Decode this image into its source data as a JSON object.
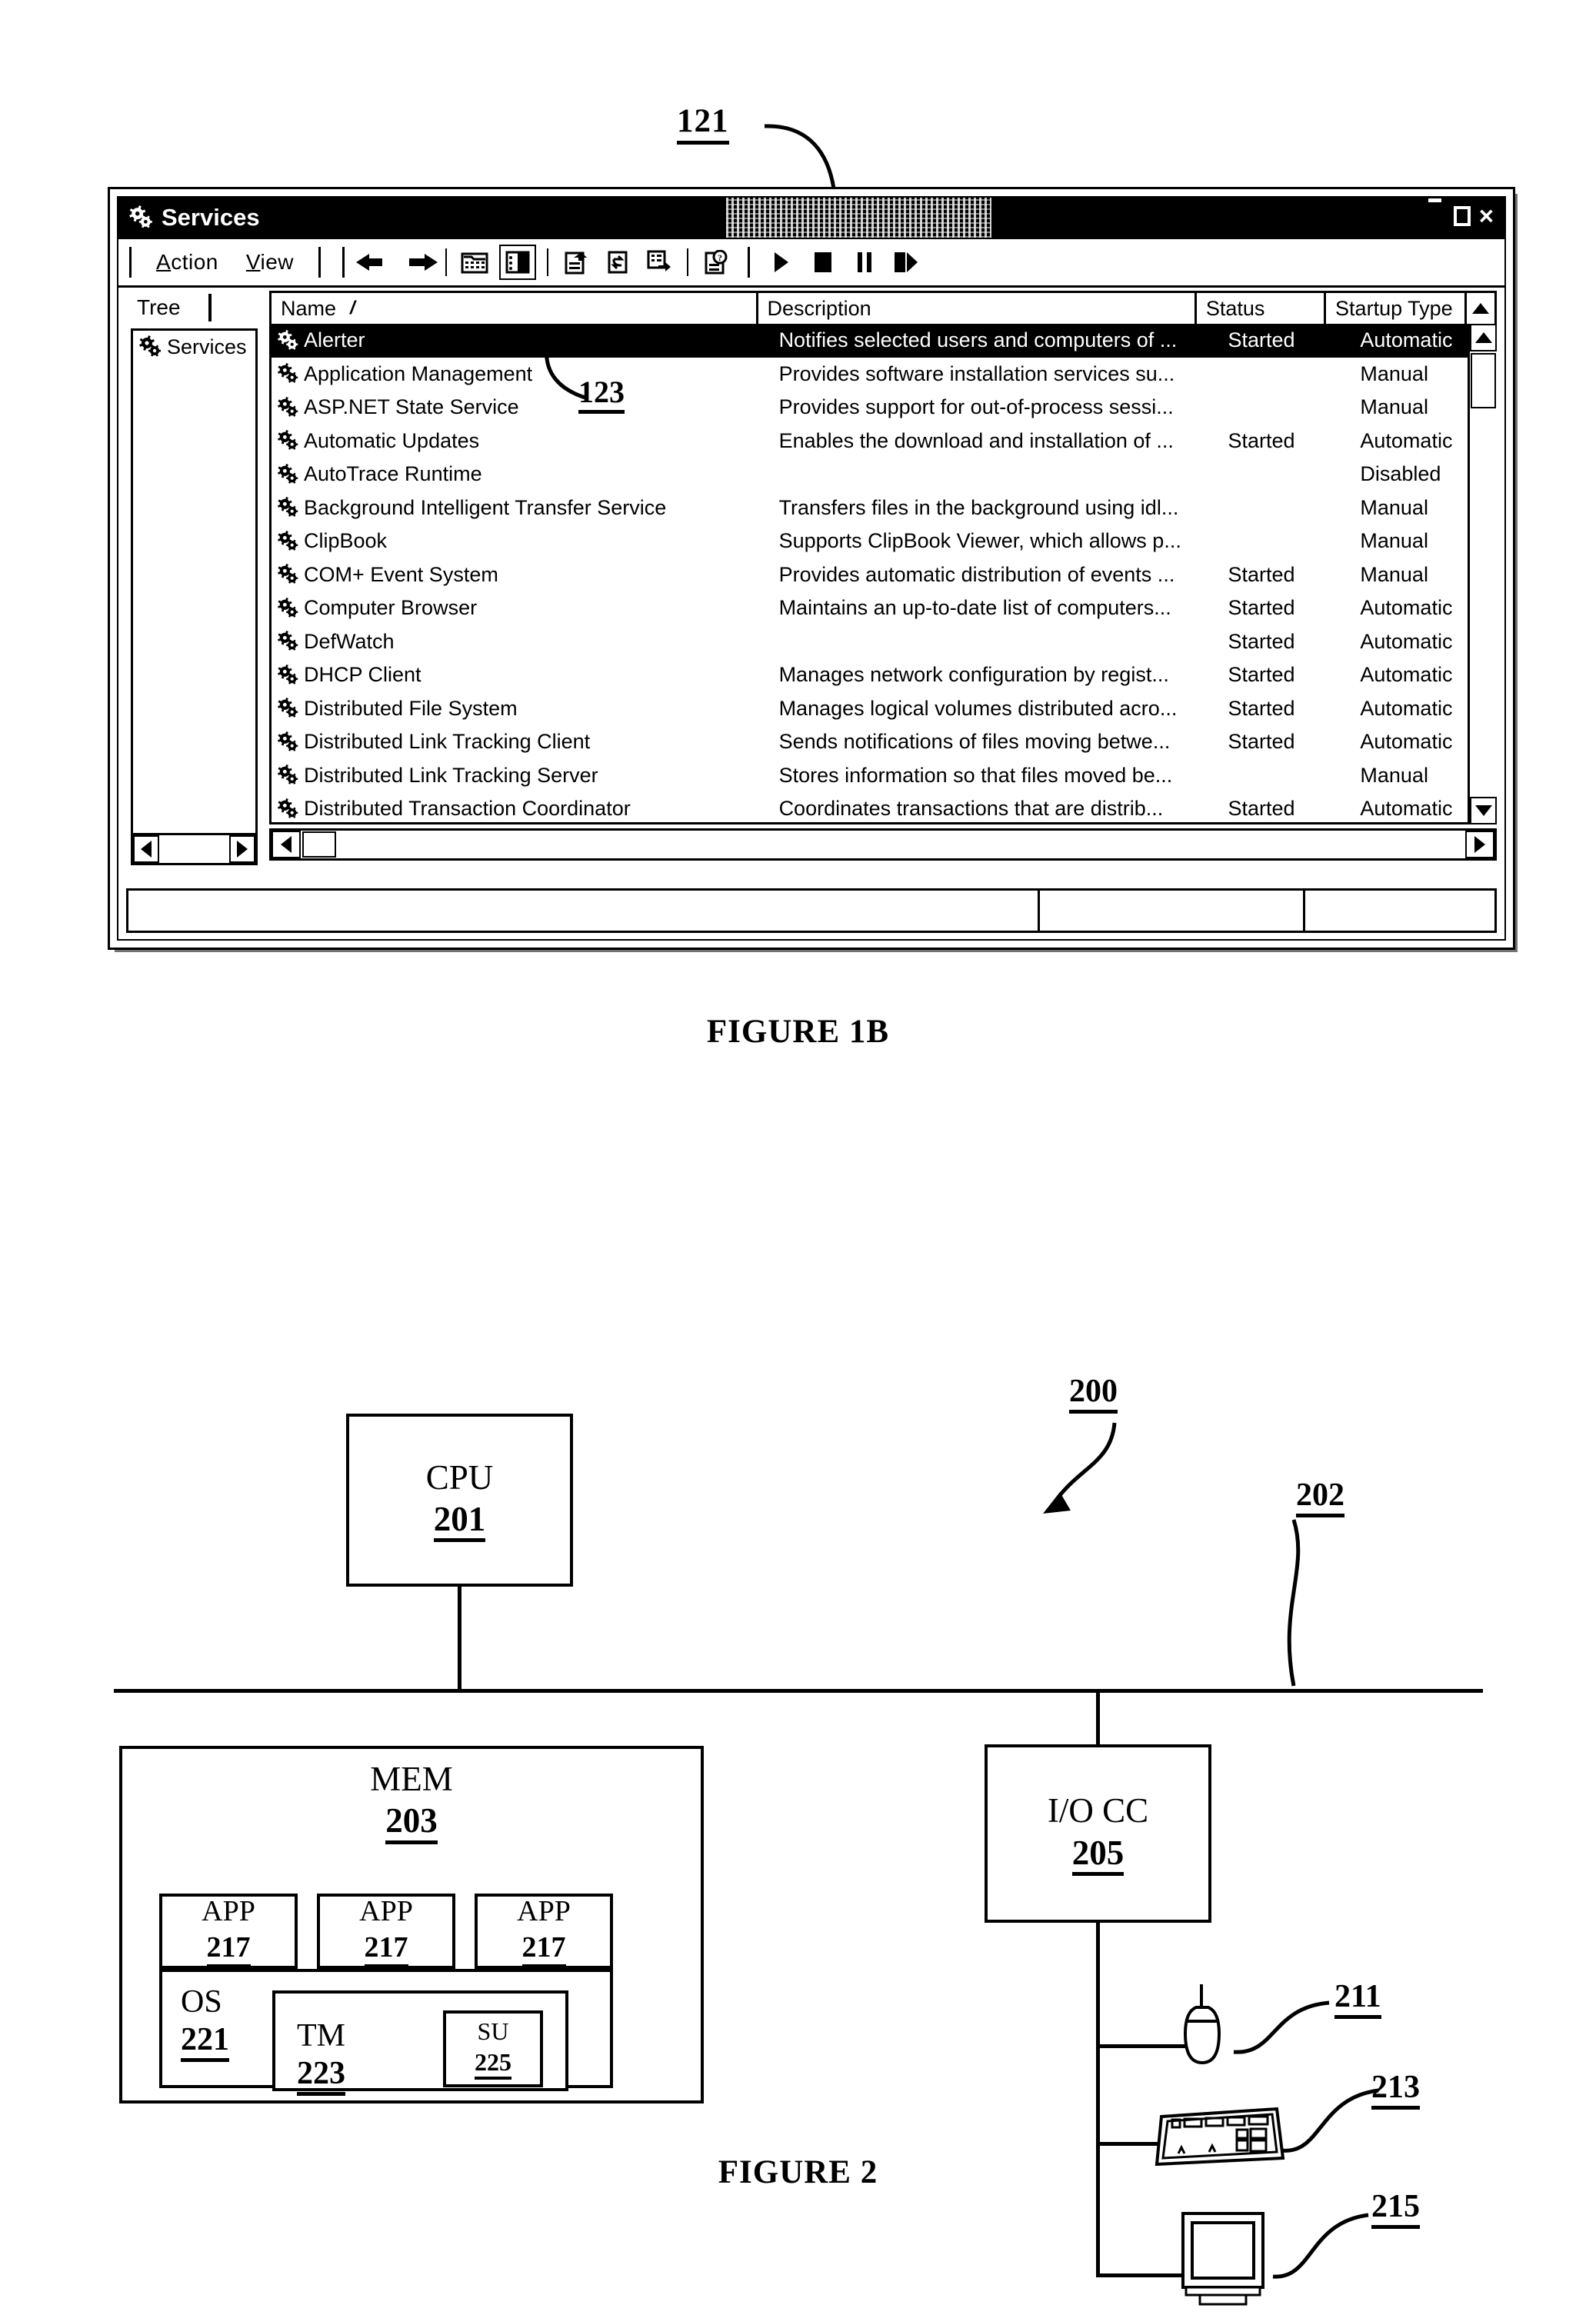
{
  "figure1b": {
    "caption": "FIGURE 1B",
    "callouts": {
      "window_ref": "121",
      "row_ref": "123"
    },
    "window": {
      "title": "Services",
      "title_icon": "services-gear-icon",
      "controls": {
        "minimize": "_",
        "maximize": "□",
        "close": "×"
      },
      "menu": [
        {
          "label": "Action",
          "accel": "A"
        },
        {
          "label": "View",
          "accel": "V"
        }
      ],
      "toolbar_buttons": [
        "back-arrow-icon",
        "forward-arrow-icon",
        "up-folder-icon",
        "show-hide-console-tree-icon",
        "export-list-icon",
        "refresh-icon",
        "new-item-icon",
        "help-icon",
        "start-service-icon",
        "stop-service-icon",
        "pause-service-icon",
        "restart-service-icon"
      ],
      "tree": {
        "header": "Tree",
        "nodes": [
          {
            "label": "Services",
            "icon": "services-gear-icon"
          }
        ]
      },
      "list": {
        "columns": [
          "Name",
          "Description",
          "Status",
          "Startup Type"
        ],
        "sort_indicator": "/",
        "rows": [
          {
            "name": "Alerter",
            "description": "Notifies selected users and computers of ...",
            "status": "Started",
            "startup": "Automatic",
            "selected": true
          },
          {
            "name": "Application Management",
            "description": "Provides software installation services su...",
            "status": "",
            "startup": "Manual",
            "selected": false
          },
          {
            "name": "ASP.NET State Service",
            "description": "Provides support for out-of-process sessi...",
            "status": "",
            "startup": "Manual",
            "selected": false
          },
          {
            "name": "Automatic Updates",
            "description": "Enables the download and installation of ...",
            "status": "Started",
            "startup": "Automatic",
            "selected": false
          },
          {
            "name": "AutoTrace Runtime",
            "description": "",
            "status": "",
            "startup": "Disabled",
            "selected": false
          },
          {
            "name": "Background Intelligent Transfer Service",
            "description": "Transfers files in the background using idl...",
            "status": "",
            "startup": "Manual",
            "selected": false
          },
          {
            "name": "ClipBook",
            "description": "Supports ClipBook Viewer, which allows p...",
            "status": "",
            "startup": "Manual",
            "selected": false
          },
          {
            "name": "COM+ Event System",
            "description": "Provides automatic distribution of events ...",
            "status": "Started",
            "startup": "Manual",
            "selected": false
          },
          {
            "name": "Computer Browser",
            "description": "Maintains an up-to-date list of computers...",
            "status": "Started",
            "startup": "Automatic",
            "selected": false
          },
          {
            "name": "DefWatch",
            "description": "",
            "status": "Started",
            "startup": "Automatic",
            "selected": false
          },
          {
            "name": "DHCP Client",
            "description": "Manages network configuration by regist...",
            "status": "Started",
            "startup": "Automatic",
            "selected": false
          },
          {
            "name": "Distributed File System",
            "description": "Manages logical volumes distributed acro...",
            "status": "Started",
            "startup": "Automatic",
            "selected": false
          },
          {
            "name": "Distributed Link Tracking Client",
            "description": "Sends notifications of files moving betwe...",
            "status": "Started",
            "startup": "Automatic",
            "selected": false
          },
          {
            "name": "Distributed Link Tracking Server",
            "description": "Stores information so that files moved be...",
            "status": "",
            "startup": "Manual",
            "selected": false
          },
          {
            "name": "Distributed Transaction Coordinator",
            "description": "Coordinates transactions that are distrib...",
            "status": "Started",
            "startup": "Automatic",
            "selected": false
          }
        ]
      }
    }
  },
  "figure2": {
    "caption": "FIGURE 2",
    "system_ref": "200",
    "bus_ref": "202",
    "blocks": {
      "cpu": {
        "title": "CPU",
        "ref": "201"
      },
      "mem": {
        "title": "MEM",
        "ref": "203"
      },
      "app1": {
        "title": "APP",
        "ref": "217"
      },
      "app2": {
        "title": "APP",
        "ref": "217"
      },
      "app3": {
        "title": "APP",
        "ref": "217"
      },
      "os": {
        "title": "OS",
        "ref": "221"
      },
      "tm": {
        "title": "TM",
        "ref": "223"
      },
      "su": {
        "title": "SU",
        "ref": "225"
      },
      "iocc": {
        "title": "I/O CC",
        "ref": "205"
      }
    },
    "peripherals": [
      {
        "icon": "mouse-icon",
        "ref": "211"
      },
      {
        "icon": "keyboard-icon",
        "ref": "213"
      },
      {
        "icon": "monitor-icon",
        "ref": "215"
      }
    ]
  }
}
